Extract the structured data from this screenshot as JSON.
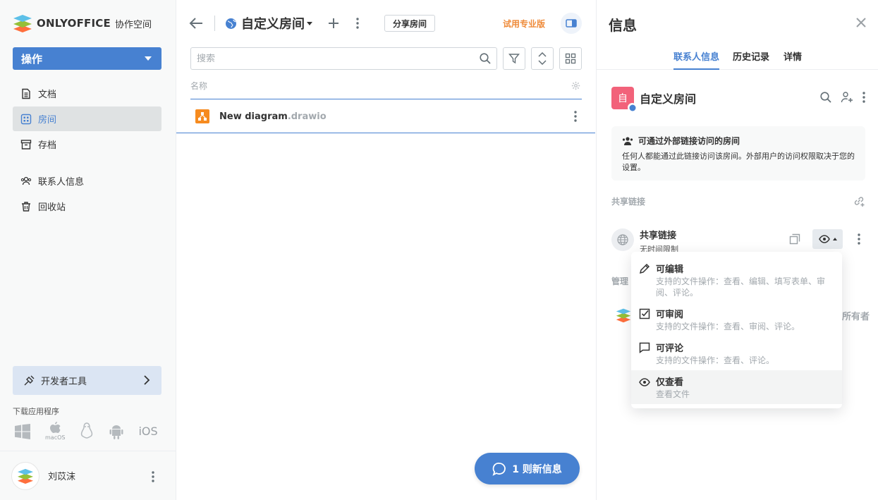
{
  "app": {
    "brand": "ONLYOFFICE",
    "brand_sub": "协作空间"
  },
  "sidebar": {
    "actions_label": "操作",
    "items": [
      {
        "label": "文档",
        "icon": "document-icon"
      },
      {
        "label": "房间",
        "icon": "rooms-icon",
        "active": true
      },
      {
        "label": "存档",
        "icon": "archive-icon"
      },
      {
        "label": "联系人信息",
        "icon": "contacts-icon"
      },
      {
        "label": "回收站",
        "icon": "trash-icon"
      }
    ],
    "dev_tools_label": "开发者工具",
    "download_label": "下载应用程序",
    "os_labels": {
      "macos": "macOS",
      "ios": "iOS"
    },
    "user_name": "刘苡沫"
  },
  "main": {
    "room_title": "自定义房间",
    "share_room_label": "分享房间",
    "trial_label": "试用专业版",
    "search_placeholder": "搜索",
    "column_name": "名称",
    "file": {
      "name": "New diagram",
      "ext": ".drawio"
    },
    "chat_label": "1 则新信息"
  },
  "info": {
    "title": "信息",
    "tabs": [
      "联系人信息",
      "历史记录",
      "详情"
    ],
    "room_logo_letter": "自",
    "room_name": "自定义房间",
    "notice_title": "可通过外部链接访问的房间",
    "notice_desc": "任何人都能通过此链接访问该房间。外部用户的访问权限取决于您的设置。",
    "shared_links_label": "共享链接",
    "link_title": "共享链接",
    "link_sub": "无时间限制",
    "behind_label": "管理",
    "behind_owner": "所有者"
  },
  "dropdown": {
    "items": [
      {
        "title": "可编辑",
        "desc": "支持的文件操作：查看、编辑、填写表单、审阅、评论。",
        "icon": "pencil-icon"
      },
      {
        "title": "可审阅",
        "desc": "支持的文件操作：查看、审阅、评论。",
        "icon": "review-icon"
      },
      {
        "title": "可评论",
        "desc": "支持的文件操作：查看、评论。",
        "icon": "comment-icon"
      },
      {
        "title": "仅查看",
        "desc": "查看文件",
        "icon": "eye-icon",
        "active": true
      }
    ]
  },
  "colors": {
    "accent": "#4781d1",
    "trial": "#ef8b3a",
    "file_icon": "#f68b1f",
    "room_logo": "#f2627a"
  }
}
